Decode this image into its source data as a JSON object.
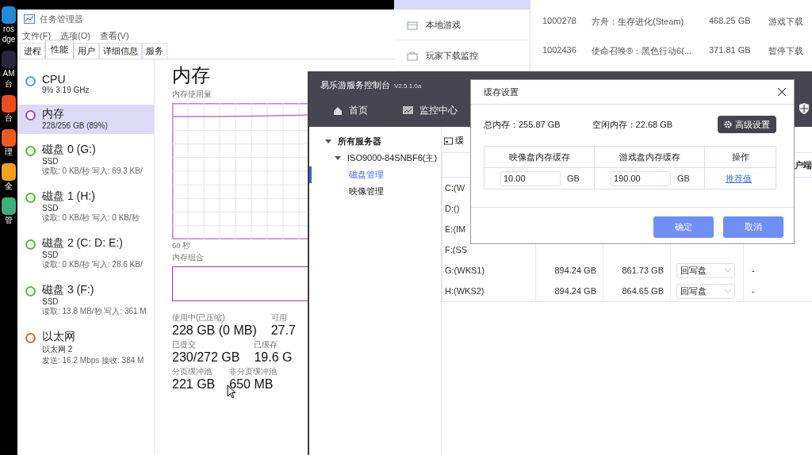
{
  "desktop_icons": [
    {
      "color": "#1f8ad8",
      "labels": [
        "ros",
        "dge"
      ]
    },
    {
      "color": "#2a2540",
      "labels": [
        "AM",
        "台"
      ]
    },
    {
      "color": "#f04a1a",
      "labels": [
        "台"
      ]
    },
    {
      "color": "#f25a1c",
      "labels": [
        "理"
      ]
    },
    {
      "color": "#f5a21a",
      "labels": [
        "全"
      ]
    },
    {
      "color": "#3bb07a",
      "labels": [
        "管"
      ]
    }
  ],
  "task_manager": {
    "title": "任务管理器",
    "menu": [
      "文件(F)",
      "选项(O)",
      "查看(V)"
    ],
    "tabs": [
      {
        "label": "进程",
        "selected": false
      },
      {
        "label": "性能",
        "selected": true
      },
      {
        "label": "用户",
        "selected": false
      },
      {
        "label": "详细信息",
        "selected": false
      },
      {
        "label": "服务",
        "selected": false
      }
    ],
    "resources": [
      {
        "name": "CPU",
        "subtitle": "9% 3.19 GHz",
        "color": "#5b9bd5",
        "selected": false
      },
      {
        "name": "内存",
        "subtitle": "228/256 GB (89%)",
        "color": "#a24cbd",
        "selected": true
      },
      {
        "name": "磁盘 0 (G:)",
        "subtitle": "SSD",
        "detail": "读取: 0 KB/秒 写入: 69.3 KB/",
        "color": "#5cb83c",
        "selected": false
      },
      {
        "name": "磁盘 1 (H:)",
        "subtitle": "SSD",
        "detail": "读取: 0 KB/秒 写入: 0 KB/秒",
        "color": "#5cb83c",
        "selected": false
      },
      {
        "name": "磁盘 2 (C: D: E:)",
        "subtitle": "SSD",
        "detail": "读取: 0 KB/秒 写入: 28.6 KB/",
        "color": "#5cb83c",
        "selected": false
      },
      {
        "name": "磁盘 3 (F:)",
        "subtitle": "SSD",
        "detail": "读取: 13.8 MB/秒 写入: 361 M",
        "color": "#5cb83c",
        "selected": false
      },
      {
        "name": "以太网",
        "subtitle": "以太网 2",
        "detail": "发送: 16.2 Mbps 接收: 384 M",
        "color": "#c9783a",
        "selected": false
      }
    ],
    "detail": {
      "title": "内存",
      "chart_label": "内存使用量",
      "time_label": "60 秒",
      "composition_label": "内存组合",
      "stats": [
        [
          {
            "label": "使用中(已压缩)",
            "value": "228 GB (0 MB)"
          },
          {
            "label": "可用",
            "value": "27.7"
          }
        ],
        [
          {
            "label": "已提交",
            "value": "230/272 GB"
          },
          {
            "label": "已缓存",
            "value": "19.6 G"
          }
        ],
        [
          {
            "label": "分页缓冲池",
            "value": "221 GB"
          },
          {
            "label": "非分页缓冲池",
            "value": "650 MB"
          }
        ]
      ]
    }
  },
  "background_app": {
    "nav": [
      "本地游戏",
      "玩家下载监控"
    ],
    "downloads": [
      {
        "id": "1000278",
        "name": "方舟：生存进化(Steam)",
        "size": "468.25 GB",
        "status": "游戏下载"
      },
      {
        "id": "1002436",
        "name": "使命召唤®：黑色行动6(...",
        "size": "371.81 GB",
        "status": "暂停下载"
      }
    ]
  },
  "console": {
    "title": "易乐游服务控制台",
    "version": "V2.5.1.0a",
    "nav": [
      "首页",
      "监控中心"
    ],
    "tree": [
      {
        "label": "所有服务器",
        "expanded": true,
        "children": [
          {
            "label": "ISO9000-84SNBF6(主)",
            "expanded": true,
            "children": [
              {
                "label": "磁盘管理",
                "selected": true
              },
              {
                "label": "映像管理",
                "selected": false
              }
            ]
          }
        ]
      }
    ],
    "panel_tab": "缓",
    "column_5_header": "户端",
    "disks": [
      {
        "name": "C:(W"
      },
      {
        "name": "D:()"
      },
      {
        "name": "E:(IM"
      },
      {
        "name": "F:(SS"
      },
      {
        "name": "G:(WKS1)",
        "total": "894.24 GB",
        "free": "861.73 GB",
        "mode": "回写盘",
        "column_5": "-"
      },
      {
        "name": "H:(WKS2)",
        "total": "894.24 GB",
        "free": "864.65 GB",
        "mode": "回写盘",
        "column_5": "-"
      }
    ]
  },
  "dialog": {
    "title": "缓存设置",
    "total_memory": "总内存：255.87 GB",
    "free_memory": "空闲内存：22.68 GB",
    "advanced_button": "高级设置",
    "columns": [
      "映像盘内存缓存",
      "游戏盘内存缓存",
      "操作"
    ],
    "fields": [
      {
        "value": "10.00",
        "unit": "GB"
      },
      {
        "value": "190.00",
        "unit": "GB"
      }
    ],
    "action_link": "推荐值",
    "buttons": [
      "确定",
      "取消"
    ]
  }
}
